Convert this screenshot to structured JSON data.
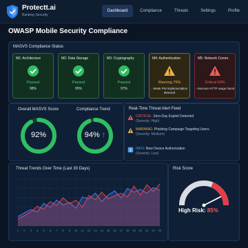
{
  "header": {
    "brand_name": "Protectt.ai",
    "brand_sub": "Banking Security",
    "nav": [
      "Dashboard",
      "Compliance",
      "Threats",
      "Settings",
      "Profile"
    ],
    "active_nav": "Dashboard"
  },
  "page_title": "OWASP Mobile Security Compliance",
  "masvs": {
    "title": "MASVS Compliance Status",
    "cards": [
      {
        "title": "M1: Architecture",
        "status": "Passed",
        "value": "98%",
        "level": "pass"
      },
      {
        "title": "M2: Data Storage",
        "status": "Passed",
        "value": "95%",
        "level": "pass"
      },
      {
        "title": "M3: Cryptography",
        "status": "Passed",
        "value": "97%",
        "level": "pass"
      },
      {
        "title": "M4: Authentication",
        "status": "Warning 75%",
        "value": "- Weak PIN implementation detected",
        "level": "warn"
      },
      {
        "title": "M5: Network Comm.",
        "status": "Critical 60%",
        "value": "- Insecure HTTP usage found",
        "level": "crit"
      }
    ]
  },
  "overall": {
    "label": "Overall MASVS Score",
    "value": "92%",
    "fraction": 0.92
  },
  "trend": {
    "label": "Compliance Trend",
    "value": "94%",
    "arrow": "↑",
    "fraction": 0.94
  },
  "alerts": {
    "title": "Real-Time Threat Alert Feed",
    "items": [
      {
        "level": "CRITICAL:",
        "text": "Zero-Day Exploit Detected",
        "sub": "(Severity: High)"
      },
      {
        "level": "WARNING:",
        "text": "Phishing Campaign Targeting Users",
        "sub": "(Severity: Medium)"
      },
      {
        "level": "INFO:",
        "text": "New Device Authorization",
        "sub": "(Severity: Low)"
      }
    ]
  },
  "threat_trends": {
    "title": "Threat Trends Over Time (Last 30 Days)"
  },
  "risk": {
    "title": "Risk Score",
    "label": "High Risk:",
    "value": "85%",
    "fraction": 0.85
  },
  "chart_data": {
    "type": "area",
    "title": "Threat Trends Over Time (Last 30 Days)",
    "x": [
      1,
      2,
      3,
      4,
      5,
      6,
      7,
      8,
      9,
      10,
      11,
      12,
      13,
      14,
      15,
      16,
      17,
      18,
      19,
      20,
      21,
      22,
      23
    ],
    "ylim": [
      0,
      100
    ],
    "yticks": [
      0,
      20,
      40,
      60,
      80,
      100
    ],
    "grid": true,
    "series": [
      {
        "values": [
          20,
          28,
          35,
          30,
          48,
          40,
          55,
          45,
          50,
          38,
          62,
          58,
          70,
          52,
          66,
          75,
          60,
          80,
          72,
          78,
          70,
          82,
          76
        ],
        "color": "#4f7df2"
      },
      {
        "values": [
          15,
          22,
          30,
          42,
          36,
          52,
          44,
          60,
          48,
          55,
          40,
          65,
          56,
          72,
          58,
          64,
          70,
          62,
          85,
          66,
          88,
          74,
          90
        ],
        "color": "#e0455a"
      }
    ]
  },
  "colors": {
    "accent": "#2fbf62",
    "warning": "#e5b445",
    "critical": "#f15b5b",
    "info": "#4f9df2"
  }
}
